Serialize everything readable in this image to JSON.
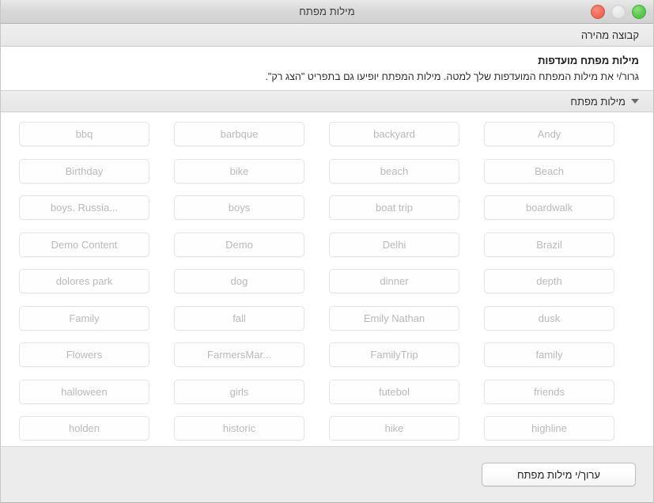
{
  "window": {
    "title": "מילות מפתח",
    "controls": [
      {
        "name": "close-button",
        "color": "#ef6e5e",
        "label": ""
      },
      {
        "name": "minimize-button",
        "color": "#e6e6e6",
        "label": ""
      },
      {
        "name": "zoom-button",
        "color": "#5cc84d",
        "label": ""
      }
    ]
  },
  "tabstrip": {
    "label": "קבוצה מהירה"
  },
  "description": {
    "title": "מילות מפתח מועדפות",
    "body": "גרור/י את מילות המפתח המועדפות שלך למטה. מילות המפתח יופיעו גם בתפריט \"הצג רק\"."
  },
  "disclosure": {
    "label": "מילות מפתח",
    "icon": "triangle-down-icon",
    "expanded": true
  },
  "keywords": [
    "bbq",
    "barbque",
    "backyard",
    "Andy",
    "Birthday",
    "bike",
    "beach",
    "Beach",
    "boys. Russia...",
    "boys",
    "boat trip",
    "boardwalk",
    "Demo Content",
    "Demo",
    "Delhi",
    "Brazil",
    "dolores park",
    "dog",
    "dinner",
    "depth",
    "Family",
    "fall",
    "Emily Nathan",
    "dusk",
    "Flowers",
    "FarmersMar...",
    "FamilyTrip",
    "family",
    "halloween",
    "girls",
    "futebol",
    "friends",
    "holden",
    "historic",
    "hike",
    "highline"
  ],
  "bottombar": {
    "edit_button_label": "ערוך/י מילות מפתח"
  },
  "colors": {
    "chip_text": "#b9b9b9",
    "chip_border": "#e4e4e4",
    "content_bg": "#ffffff",
    "chrome_bg": "#ececec"
  }
}
